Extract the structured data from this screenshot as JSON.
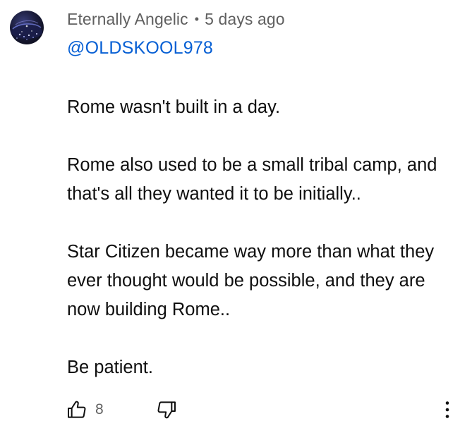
{
  "comment": {
    "author": "Eternally Angelic",
    "separator": "•",
    "timestamp": "5 days ago",
    "mention": "@OLDSKOOL978",
    "paragraphs": [
      "Rome wasn't built in a day.",
      "Rome also used to be a small tribal camp, and that's all they wanted it to be initially..",
      "Star Citizen became way more than what they ever thought would be possible, and they are now building Rome..",
      "Be patient."
    ]
  },
  "actions": {
    "like_icon": "thumbs-up-icon",
    "like_count": "8",
    "dislike_icon": "thumbs-down-icon",
    "more_icon": "more-vertical-icon"
  },
  "colors": {
    "meta_text": "#606060",
    "mention_link": "#065fd4",
    "body_text": "#0f0f0f"
  }
}
